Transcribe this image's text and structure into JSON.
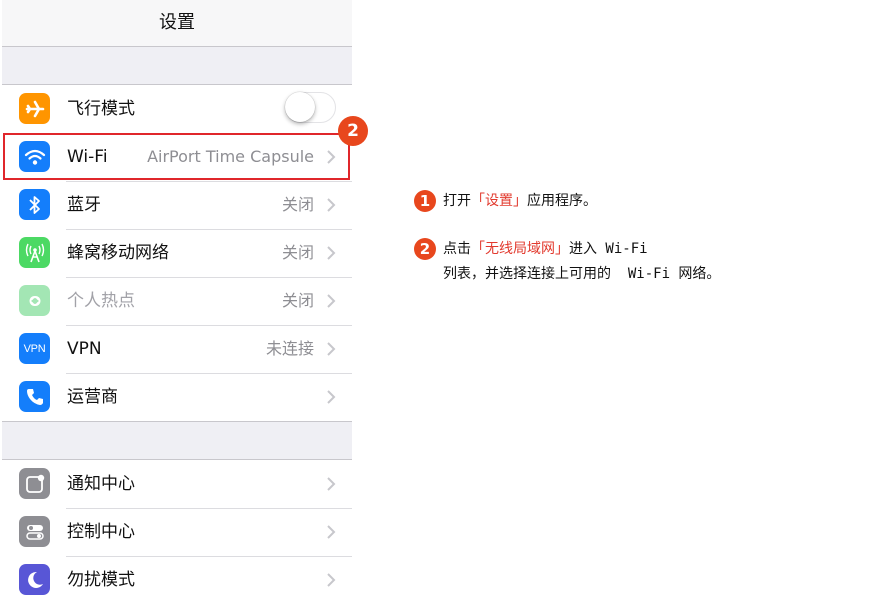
{
  "nav": {
    "title": "设置"
  },
  "colors": {
    "accent_red": "#e0262b",
    "badge_orange": "#e8471d"
  },
  "groups": [
    {
      "rows": [
        {
          "icon": "airplane-icon",
          "icon_bg": "#ff9500",
          "label": "飞行模式",
          "value": "",
          "toggle": "off"
        },
        {
          "icon": "wifi-icon",
          "icon_bg": "#147efb",
          "label": "Wi-Fi",
          "value": "AirPort Time Capsule"
        },
        {
          "icon": "bluetooth-icon",
          "icon_bg": "#147efb",
          "label": "蓝牙",
          "value": "关闭"
        },
        {
          "icon": "cellular-icon",
          "icon_bg": "#4cd964",
          "label": "蜂窝移动网络",
          "value": "关闭"
        },
        {
          "icon": "hotspot-icon",
          "icon_bg": "#a3e6b4",
          "label": "个人热点",
          "value": "关闭"
        },
        {
          "icon": "vpn-icon",
          "icon_bg": "#147efb",
          "label": "VPN",
          "value": "未连接",
          "icon_text": "VPN"
        },
        {
          "icon": "phone-icon",
          "icon_bg": "#147efb",
          "label": "运营商",
          "value": ""
        }
      ]
    },
    {
      "rows": [
        {
          "icon": "notification-center-icon",
          "icon_bg": "#8e8e93",
          "label": "通知中心",
          "value": ""
        },
        {
          "icon": "control-center-icon",
          "icon_bg": "#8e8e93",
          "label": "控制中心",
          "value": ""
        },
        {
          "icon": "moon-icon",
          "icon_bg": "#5856d6",
          "label": "勿扰模式",
          "value": ""
        }
      ]
    }
  ],
  "callout": {
    "number": "2"
  },
  "steps": [
    {
      "number": "1",
      "pre": "打开",
      "highlight": "「设置」",
      "post": "应用程序。"
    },
    {
      "number": "2",
      "pre": "点击",
      "highlight": "「无线局域网」",
      "post": "进入 Wi-Fi",
      "line2": "列表，并选择连接上可用的  Wi-Fi 网络。"
    }
  ]
}
